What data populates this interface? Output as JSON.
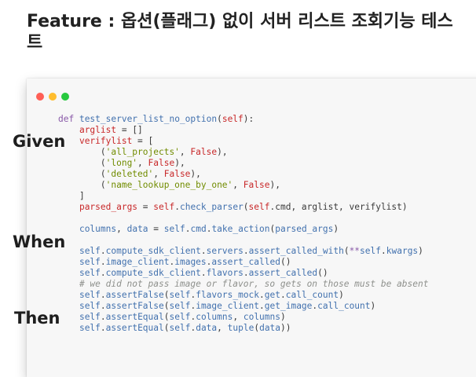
{
  "heading": {
    "keyword": "Feature",
    "rest": " : 옵션(플래그) 없이 서버 리스트 조회기능 테스트"
  },
  "labels": {
    "given": "Given",
    "when": "When",
    "then": "Then"
  },
  "window_dots": [
    "red",
    "yellow",
    "green"
  ],
  "colors": {
    "keyword": "#8959a8",
    "function": "#4271ae",
    "string": "#718c00",
    "boolean": "#c82829",
    "comment": "#8e908c"
  },
  "code_lines": [
    [
      [
        "k",
        "def "
      ],
      [
        "f",
        "test_server_list_no_option"
      ],
      [
        "p",
        "("
      ],
      [
        "b",
        "self"
      ],
      [
        "p",
        "):"
      ]
    ],
    [
      [
        "p",
        "    "
      ],
      [
        "b",
        "arglist"
      ],
      [
        "p",
        " = []"
      ]
    ],
    [
      [
        "p",
        "    "
      ],
      [
        "b",
        "verifylist"
      ],
      [
        "p",
        " = ["
      ]
    ],
    [
      [
        "p",
        "        ("
      ],
      [
        "s",
        "'all_projects'"
      ],
      [
        "p",
        ", "
      ],
      [
        "b",
        "False"
      ],
      [
        "p",
        "),"
      ]
    ],
    [
      [
        "p",
        "        ("
      ],
      [
        "s",
        "'long'"
      ],
      [
        "p",
        ", "
      ],
      [
        "b",
        "False"
      ],
      [
        "p",
        "),"
      ]
    ],
    [
      [
        "p",
        "        ("
      ],
      [
        "s",
        "'deleted'"
      ],
      [
        "p",
        ", "
      ],
      [
        "b",
        "False"
      ],
      [
        "p",
        "),"
      ]
    ],
    [
      [
        "p",
        "        ("
      ],
      [
        "s",
        "'name_lookup_one_by_one'"
      ],
      [
        "p",
        ", "
      ],
      [
        "b",
        "False"
      ],
      [
        "p",
        "),"
      ]
    ],
    [
      [
        "p",
        "    ]"
      ]
    ],
    [
      [
        "p",
        "    "
      ],
      [
        "b",
        "parsed_args"
      ],
      [
        "p",
        " = "
      ],
      [
        "b",
        "self"
      ],
      [
        "p",
        "."
      ],
      [
        "f",
        "check_parser"
      ],
      [
        "p",
        "("
      ],
      [
        "b",
        "self"
      ],
      [
        "p",
        ".cmd, arglist, verifylist)"
      ]
    ],
    [
      [
        "p",
        ""
      ]
    ],
    [
      [
        "p",
        "    "
      ],
      [
        "f",
        "columns"
      ],
      [
        "p",
        ", "
      ],
      [
        "f",
        "data"
      ],
      [
        "p",
        " = "
      ],
      [
        "f",
        "self"
      ],
      [
        "p",
        "."
      ],
      [
        "f",
        "cmd"
      ],
      [
        "p",
        "."
      ],
      [
        "f",
        "take_action"
      ],
      [
        "p",
        "("
      ],
      [
        "f",
        "parsed_args"
      ],
      [
        "p",
        ")"
      ]
    ],
    [
      [
        "p",
        ""
      ]
    ],
    [
      [
        "p",
        "    "
      ],
      [
        "f",
        "self"
      ],
      [
        "p",
        "."
      ],
      [
        "f",
        "compute_sdk_client"
      ],
      [
        "p",
        "."
      ],
      [
        "f",
        "servers"
      ],
      [
        "p",
        "."
      ],
      [
        "f",
        "assert_called_with"
      ],
      [
        "p",
        "("
      ],
      [
        "k",
        "**"
      ],
      [
        "f",
        "self"
      ],
      [
        "p",
        "."
      ],
      [
        "f",
        "kwargs"
      ],
      [
        "p",
        ")"
      ]
    ],
    [
      [
        "p",
        "    "
      ],
      [
        "f",
        "self"
      ],
      [
        "p",
        "."
      ],
      [
        "f",
        "image_client"
      ],
      [
        "p",
        "."
      ],
      [
        "f",
        "images"
      ],
      [
        "p",
        "."
      ],
      [
        "f",
        "assert_called"
      ],
      [
        "p",
        "()"
      ]
    ],
    [
      [
        "p",
        "    "
      ],
      [
        "f",
        "self"
      ],
      [
        "p",
        "."
      ],
      [
        "f",
        "compute_sdk_client"
      ],
      [
        "p",
        "."
      ],
      [
        "f",
        "flavors"
      ],
      [
        "p",
        "."
      ],
      [
        "f",
        "assert_called"
      ],
      [
        "p",
        "()"
      ]
    ],
    [
      [
        "c",
        "    # we did not pass image or flavor, so gets on those must be absent"
      ]
    ],
    [
      [
        "p",
        "    "
      ],
      [
        "f",
        "self"
      ],
      [
        "p",
        "."
      ],
      [
        "f",
        "assertFalse"
      ],
      [
        "p",
        "("
      ],
      [
        "f",
        "self"
      ],
      [
        "p",
        "."
      ],
      [
        "f",
        "flavors_mock"
      ],
      [
        "p",
        "."
      ],
      [
        "f",
        "get"
      ],
      [
        "p",
        "."
      ],
      [
        "f",
        "call_count"
      ],
      [
        "p",
        ")"
      ]
    ],
    [
      [
        "p",
        "    "
      ],
      [
        "f",
        "self"
      ],
      [
        "p",
        "."
      ],
      [
        "f",
        "assertFalse"
      ],
      [
        "p",
        "("
      ],
      [
        "f",
        "self"
      ],
      [
        "p",
        "."
      ],
      [
        "f",
        "image_client"
      ],
      [
        "p",
        "."
      ],
      [
        "f",
        "get_image"
      ],
      [
        "p",
        "."
      ],
      [
        "f",
        "call_count"
      ],
      [
        "p",
        ")"
      ]
    ],
    [
      [
        "p",
        "    "
      ],
      [
        "f",
        "self"
      ],
      [
        "p",
        "."
      ],
      [
        "f",
        "assertEqual"
      ],
      [
        "p",
        "("
      ],
      [
        "f",
        "self"
      ],
      [
        "p",
        "."
      ],
      [
        "f",
        "columns"
      ],
      [
        "p",
        ", "
      ],
      [
        "f",
        "columns"
      ],
      [
        "p",
        ")"
      ]
    ],
    [
      [
        "p",
        "    "
      ],
      [
        "f",
        "self"
      ],
      [
        "p",
        "."
      ],
      [
        "f",
        "assertEqual"
      ],
      [
        "p",
        "("
      ],
      [
        "f",
        "self"
      ],
      [
        "p",
        "."
      ],
      [
        "f",
        "data"
      ],
      [
        "p",
        ", "
      ],
      [
        "f",
        "tuple"
      ],
      [
        "p",
        "("
      ],
      [
        "f",
        "data"
      ],
      [
        "p",
        "))"
      ]
    ]
  ]
}
